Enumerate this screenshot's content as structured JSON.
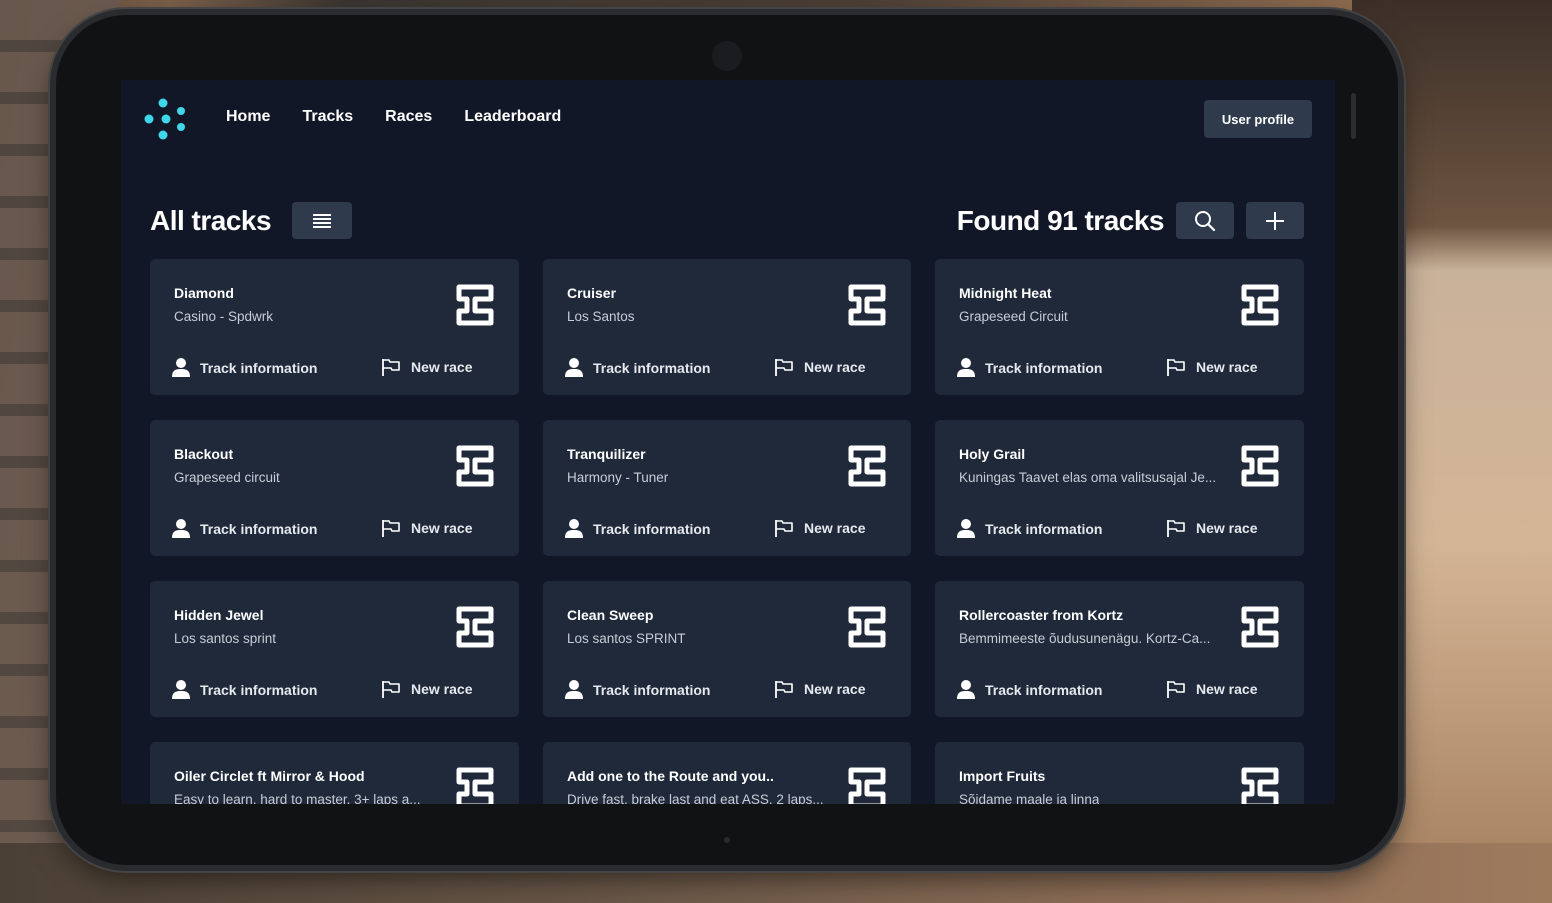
{
  "nav": {
    "links": [
      "Home",
      "Tracks",
      "Races",
      "Leaderboard"
    ],
    "user_profile": "User profile"
  },
  "header": {
    "title": "All tracks",
    "found": "Found 91 tracks"
  },
  "card_actions": {
    "info": "Track information",
    "race": "New race"
  },
  "tracks": [
    {
      "name": "Diamond",
      "sub": "Casino - Spdwrk"
    },
    {
      "name": "Cruiser",
      "sub": "Los Santos"
    },
    {
      "name": "Midnight Heat",
      "sub": "Grapeseed Circuit"
    },
    {
      "name": "Blackout",
      "sub": "Grapeseed circuit"
    },
    {
      "name": "Tranquilizer",
      "sub": "Harmony - Tuner"
    },
    {
      "name": "Holy Grail",
      "sub": "Kuningas Taavet elas oma valitsusajal Je..."
    },
    {
      "name": "Hidden Jewel",
      "sub": "Los santos sprint"
    },
    {
      "name": "Clean Sweep",
      "sub": "Los santos SPRINT"
    },
    {
      "name": "Rollercoaster from Kortz",
      "sub": "Bemmimeeste õudusunenägu. Kortz-Ca..."
    },
    {
      "name": "Oiler Circlet ft Mirror & Hood",
      "sub": "Easy to learn, hard to master. 3+ laps a..."
    },
    {
      "name": "Add one to the Route and you..",
      "sub": "Drive fast, brake last and eat ASS. 2 laps..."
    },
    {
      "name": "Import Fruits",
      "sub": "Sõidame maale ja linna"
    }
  ],
  "colors": {
    "accent": "#3ed6e8",
    "screen_bg": "#111727",
    "card_bg": "#1f293a",
    "button_bg": "#2f3b4d"
  },
  "icons": [
    "logo-icon",
    "menu-icon",
    "search-icon",
    "plus-icon",
    "track-layout-icon",
    "user-icon",
    "flag-icon"
  ]
}
